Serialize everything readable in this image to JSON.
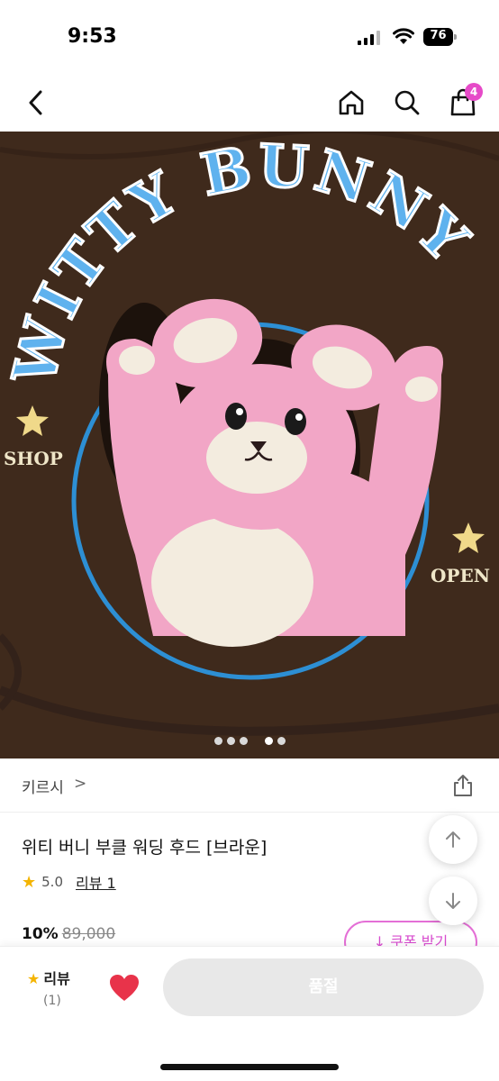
{
  "status_bar": {
    "time": "9:53",
    "battery": "76"
  },
  "nav": {
    "cart_count": "4"
  },
  "hero": {
    "arc_text": "WITTY BUNNY",
    "left_text": "SHOP",
    "right_text": "OPEN",
    "slides_total": 5,
    "active_slide": 4
  },
  "product": {
    "brand": "키르시",
    "brand_chevron": ">",
    "title": "위티 버니 부클 워딩 후드 [브라운]",
    "rating": "5.0",
    "review_link": "리뷰 1",
    "discount": "10%",
    "original_price": "89,000",
    "coupon_label": "↓ 쿠폰 받기"
  },
  "bottom_bar": {
    "review_label": "리뷰",
    "review_count": "(1)",
    "soldout_label": "품절"
  },
  "colors": {
    "accent_pink": "#e64ac8",
    "hero_bg": "#3f2a1c",
    "star": "#f4b400",
    "heart": "#e8334a"
  }
}
